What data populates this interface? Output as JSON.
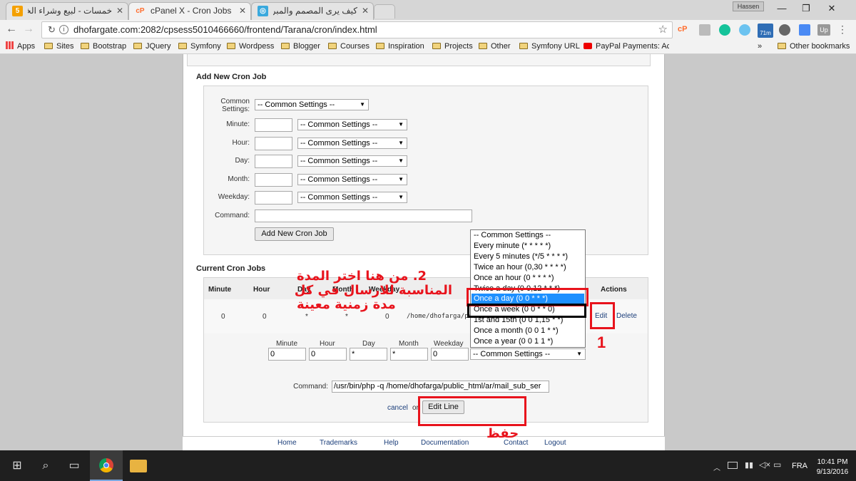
{
  "browser": {
    "tabs": [
      {
        "label": "خمسات - لبيع وشراء الخدم",
        "favicon": "5"
      },
      {
        "label": "cPanel X - Cron Jobs",
        "favicon": "cP"
      },
      {
        "label": "كيف يرى المصمم والمبرمج",
        "favicon": "◎"
      }
    ],
    "profile": "Hassen",
    "url": "dhofargate.com:2082/cpsess5010466660/frontend/Tarana/cron/index.html",
    "ext_badge": "71m",
    "bookmarks": [
      "Apps",
      "Sites",
      "Bootstrap",
      "JQuery",
      "Symfony",
      "Wordpess",
      "Blogger",
      "Courses",
      "Inspiration",
      "Projects",
      "Other",
      "Symfony URL",
      "PayPal Payments: Acc"
    ],
    "other_bookmarks": "Other bookmarks",
    "more": "»"
  },
  "add_cron": {
    "title": "Add New Cron Job",
    "common_label": "Common Settings:",
    "common_value": "-- Common Settings --",
    "fields": [
      {
        "label": "Minute:",
        "select": "-- Common Settings --"
      },
      {
        "label": "Hour:",
        "select": "-- Common Settings --"
      },
      {
        "label": "Day:",
        "select": "-- Common Settings --"
      },
      {
        "label": "Month:",
        "select": "-- Common Settings --"
      },
      {
        "label": "Weekday:",
        "select": "-- Common Settings --"
      }
    ],
    "command_label": "Command:",
    "submit": "Add New Cron Job"
  },
  "current": {
    "title": "Current Cron Jobs",
    "headers": [
      "Minute",
      "Hour",
      "Day",
      "Month",
      "Weekday",
      "Actions"
    ],
    "row": {
      "minute": "0",
      "hour": "0",
      "day": "*",
      "month": "*",
      "weekday": "0",
      "command": "/home/dhofarga/pu",
      "edit": "Edit",
      "delete": "Delete"
    },
    "edit_labels": [
      "Minute",
      "Hour",
      "Day",
      "Month",
      "Weekday"
    ],
    "edit_values": [
      "0",
      "0",
      "*",
      "*",
      "0"
    ],
    "edit_select": "-- Common Settings --",
    "command_label": "Command:",
    "command_value": "/usr/bin/php -q /home/dhofarga/public_html/ar/mail_sub_ser",
    "cancel": "cancel",
    "or": "or",
    "edit_line": "Edit Line"
  },
  "dropdown_options": [
    "-- Common Settings --",
    "Every minute (* * * * *)",
    "Every 5 minutes (*/5 * * * *)",
    "Twice an hour (0,30 * * * *)",
    "Once an hour (0 * * * *)",
    "Twice a day (0 0,12 * * *)",
    "Once a day (0 0 * * *)",
    "Once a week (0 0 * * 0)",
    "1st and 15th (0 0 1,15 * *)",
    "Once a month (0 0 1 * *)",
    "Once a year (0 0 1 1 *)"
  ],
  "footer": [
    "Home",
    "Trademarks",
    "Help",
    "Documentation",
    "Contact",
    "Logout"
  ],
  "annotations": {
    "step2_line1": "2. من هنا اختر المدة",
    "step2_line2": "المناسبة للارسال في كل",
    "step2_line3": "مدة زمنية معينة",
    "step1": "1",
    "save": "حفظ"
  },
  "taskbar": {
    "lang": "FRA",
    "time": "10:41 PM",
    "date": "9/13/2016"
  },
  "colors": {
    "annotation_red": "#e8131c",
    "selected_option": "#1e90ff"
  }
}
